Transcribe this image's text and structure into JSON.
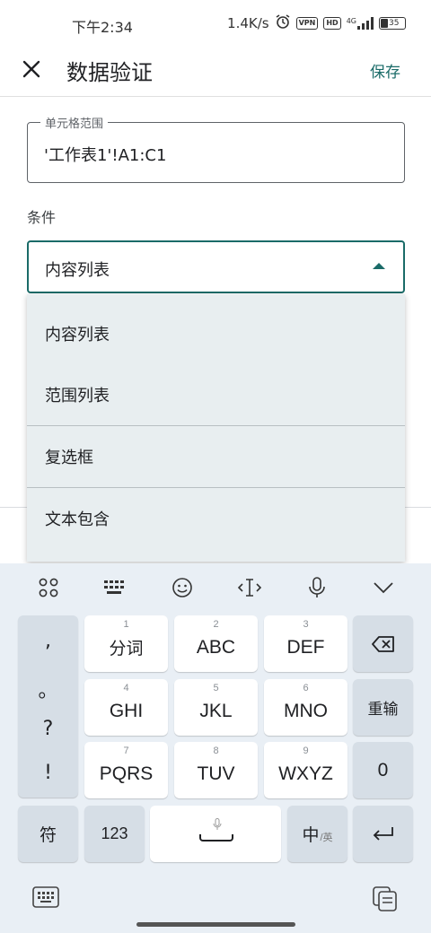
{
  "status": {
    "time": "下午2:34",
    "speed": "1.4K/s",
    "vpn": "VPN",
    "hd": "HD",
    "signal": "4G",
    "battery": "35"
  },
  "app_bar": {
    "title": "数据验证",
    "save_label": "保存"
  },
  "form": {
    "range_label": "单元格范围",
    "range_value": "'工作表1'!A1:C1",
    "condition_label": "条件",
    "condition_value": "内容列表"
  },
  "dropdown": {
    "items": [
      "内容列表",
      "范围列表",
      "复选框",
      "文本包含"
    ]
  },
  "keyboard": {
    "punct": [
      ",",
      "。",
      "?",
      "!"
    ],
    "rows": [
      [
        {
          "num": "1",
          "label": "分词"
        },
        {
          "num": "2",
          "label": "ABC"
        },
        {
          "num": "3",
          "label": "DEF"
        }
      ],
      [
        {
          "num": "4",
          "label": "GHI"
        },
        {
          "num": "5",
          "label": "JKL"
        },
        {
          "num": "6",
          "label": "MNO"
        }
      ],
      [
        {
          "num": "7",
          "label": "PQRS"
        },
        {
          "num": "8",
          "label": "TUV"
        },
        {
          "num": "9",
          "label": "WXYZ"
        }
      ]
    ],
    "reenter_label": "重输",
    "zero_label": "0",
    "symbol_label": "符",
    "num_label": "123",
    "zhong_label": "中",
    "ying_label": "/英"
  },
  "colors": {
    "accent": "#1a6b68",
    "dropdown_bg": "#e8eef0",
    "keyboard_bg": "#e9eff5"
  }
}
